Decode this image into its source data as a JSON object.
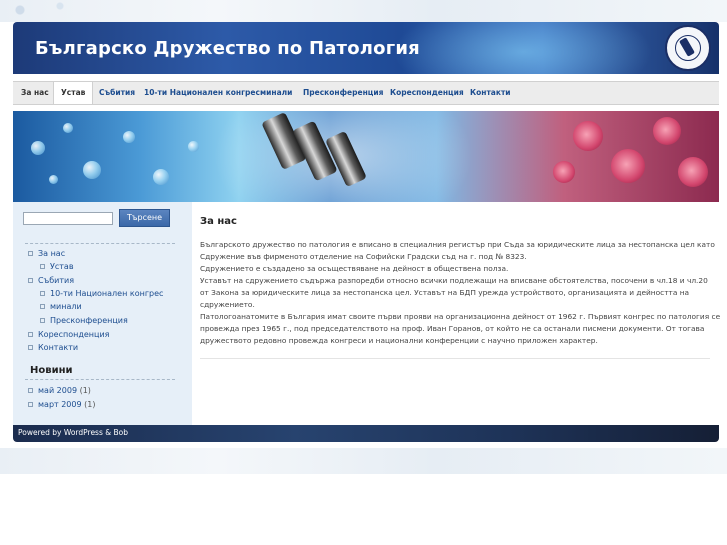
{
  "header": {
    "title": "Българско Дружество по Патология"
  },
  "nav": {
    "items": [
      {
        "label": "За нас"
      },
      {
        "label": "Устав"
      },
      {
        "label": "Събития"
      },
      {
        "label": "10-ти Национален конгрес"
      },
      {
        "label": "минали"
      },
      {
        "label": "Пресконференция"
      },
      {
        "label": "Кореспонденция"
      },
      {
        "label": "Контакти"
      }
    ]
  },
  "search": {
    "button_label": "Търсене",
    "value": ""
  },
  "sidebar": {
    "pages": [
      {
        "label": "За нас"
      },
      {
        "label": "Устав"
      },
      {
        "label": "Събития"
      },
      {
        "label": "10-ти Национален конгрес"
      },
      {
        "label": "минали"
      },
      {
        "label": "Пресконференция"
      },
      {
        "label": "Кореспонденция"
      },
      {
        "label": "Контакти"
      }
    ],
    "news_heading": "Новини",
    "archives": [
      {
        "label": "май 2009",
        "count": "(1)"
      },
      {
        "label": "март 2009",
        "count": "(1)"
      }
    ]
  },
  "main": {
    "heading": "За нас",
    "lines": [
      "Българското дружество по патология е вписано в специалния регистър при Съда за юридическите лица за нестопанска цел като",
      "Сдружение във фирменото отделение на Софийски Градски съд на г. под № 8323.",
      "Сдружението е създадено за осъществяване на дейност в обществена полза.",
      "Уставът на сдружението съдържа разпоредби относно всички подлежащи на вписване обстоятелства, посочени в чл.18 и чл.20",
      "от Закона за юридическите лица за нестопанска цел. Уставът на БДП урежда устройството, организацията и дейността на",
      "сдружението.",
      "Патологоанатомите в България имат своите първи прояви на организационна дейност от 1962 г. Първият конгрес по патология се",
      "провежда през 1965 г., под председателството на проф. Иван Горанов, от който не са останали писмени документи. От тогава",
      "дружеството редовно провежда конгреси и национални конференции с научно приложен характер."
    ]
  },
  "footer": {
    "text": "Powered by WordPress & Bob"
  }
}
